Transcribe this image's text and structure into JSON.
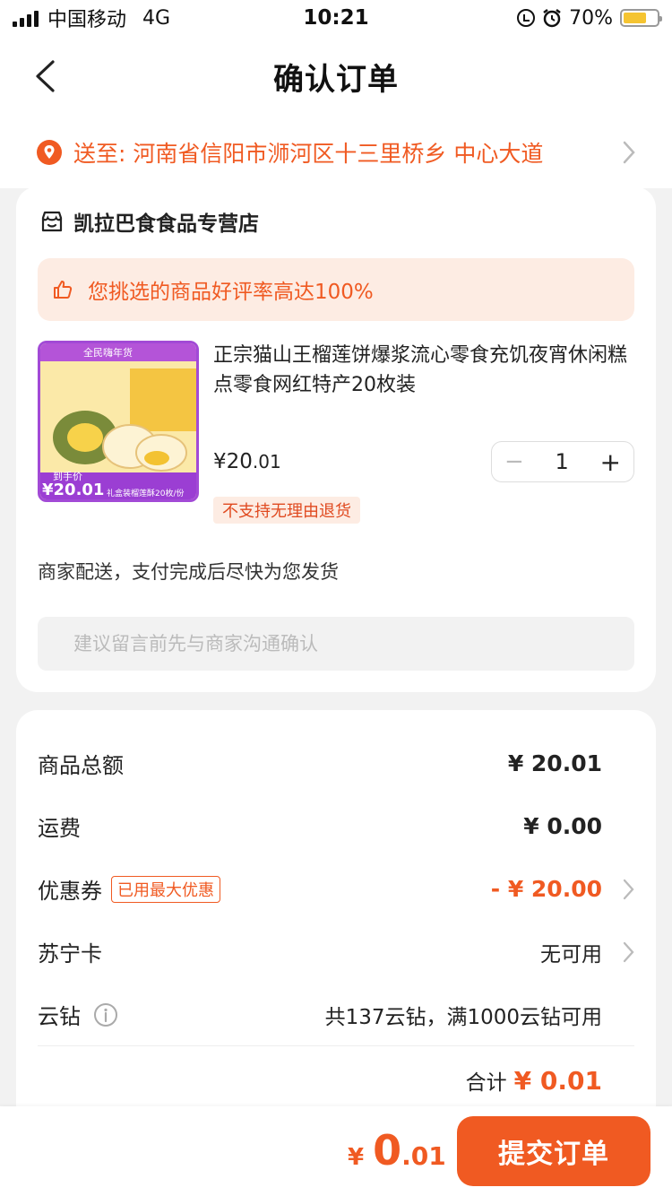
{
  "status": {
    "carrier": "中国移动",
    "network": "4G",
    "time": "10:21",
    "battery": "70%"
  },
  "nav": {
    "title": "确认订单"
  },
  "address": {
    "text": "送至: 河南省信阳市浉河区十三里桥乡 中心大道"
  },
  "store": {
    "name": "凯拉巴食食品专营店",
    "praise": "您挑选的商品好评率高达100%",
    "product": {
      "title": "正宗猫山王榴莲饼爆浆流心零食充饥夜宵休闲糕点零食网红特产20枚装",
      "price_int": "¥20",
      "price_dec": ".01",
      "quantity": "1",
      "minus": "−",
      "plus": "+",
      "no_return": "不支持无理由退货",
      "img_banner": "全民嗨年货",
      "img_price_label": "到手价",
      "img_price": "¥20.01",
      "img_caption": "礼盒装榴莲酥20枚/份"
    },
    "shipping_note": "商家配送，支付完成后尽快为您发货",
    "remark_placeholder": "建议留言前先与商家沟通确认"
  },
  "summary": {
    "goods_total_label": "商品总额",
    "goods_total": "¥ 20.01",
    "freight_label": "运费",
    "freight": "¥ 0.00",
    "coupon_label": "优惠券",
    "coupon_tag": "已用最大优惠",
    "coupon_value": "- ¥ 20.00",
    "card_label": "苏宁卡",
    "card_value": "无可用",
    "diamond_label": "云钻",
    "diamond_value": "共137云钻，满1000云钻可用",
    "total_label": "合计",
    "total_value": "¥ 0.01"
  },
  "bottom": {
    "currency": "¥",
    "amount_int": "0",
    "amount_dec": ".01",
    "submit": "提交订单"
  },
  "colors": {
    "accent": "#f05a22",
    "praise_bg": "#fdece3"
  }
}
